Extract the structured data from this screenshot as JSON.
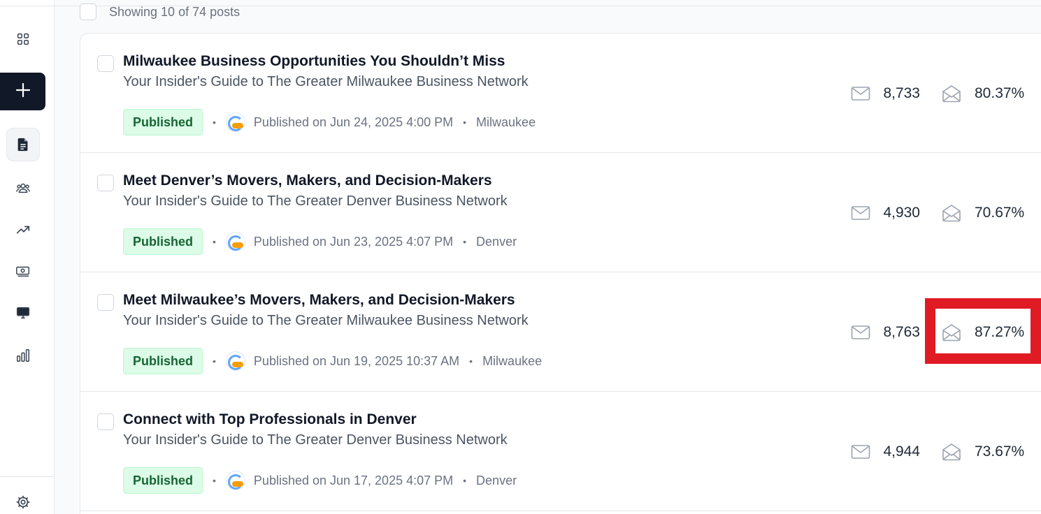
{
  "sidebar": {
    "items": [
      {
        "name": "dashboard-icon"
      },
      {
        "name": "create-icon"
      },
      {
        "name": "posts-icon"
      },
      {
        "name": "audience-icon"
      },
      {
        "name": "growth-icon"
      },
      {
        "name": "monetize-icon"
      },
      {
        "name": "website-icon"
      },
      {
        "name": "analytics-icon"
      },
      {
        "name": "settings-icon"
      }
    ]
  },
  "list": {
    "showing": "Showing 10 of 74 posts"
  },
  "posts": [
    {
      "title": "Milwaukee Business Opportunities You Shouldn’t Miss",
      "subtitle": "Your Insider's Guide to The Greater Milwaukee Business Network",
      "status": "Published",
      "published": "Published on Jun 24, 2025 4:00 PM",
      "location": "Milwaukee",
      "sent": "8,733",
      "open_rate": "80.37%"
    },
    {
      "title": "Meet Denver’s Movers, Makers, and Decision-Makers",
      "subtitle": "Your Insider's Guide to The Greater Denver Business Network",
      "status": "Published",
      "published": "Published on Jun 23, 2025 4:07 PM",
      "location": "Denver",
      "sent": "4,930",
      "open_rate": "70.67%"
    },
    {
      "title": "Meet Milwaukee’s Movers, Makers, and Decision-Makers",
      "subtitle": "Your Insider's Guide to The Greater Milwaukee Business Network",
      "status": "Published",
      "published": "Published on Jun 19, 2025 10:37 AM",
      "location": "Milwaukee",
      "sent": "8,763",
      "open_rate": "87.27%"
    },
    {
      "title": "Connect with Top Professionals in Denver",
      "subtitle": "Your Insider's Guide to The Greater Denver Business Network",
      "status": "Published",
      "published": "Published on Jun 17, 2025 4:07 PM",
      "location": "Denver",
      "sent": "4,944",
      "open_rate": "73.67%"
    }
  ],
  "colors": {
    "highlight": "#e01b24",
    "badge_bg": "#dcfce7",
    "badge_text": "#166534",
    "create_button": "#111827"
  }
}
